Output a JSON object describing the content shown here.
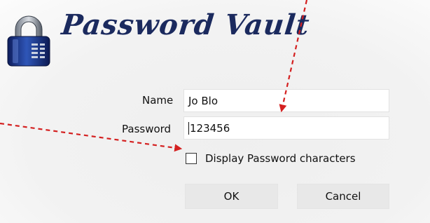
{
  "window": {
    "title": "Password Vault"
  },
  "form": {
    "name_label": "Name",
    "name_value": "Jo Blo",
    "password_label": "Password",
    "password_value": "123456",
    "show_password_label": "Display Password characters",
    "show_password_checked": false
  },
  "buttons": {
    "ok": "OK",
    "cancel": "Cancel"
  },
  "icons": {
    "logo": "padlock-icon"
  },
  "colors": {
    "title": "#1b2a5e",
    "arrow": "#d42020"
  }
}
